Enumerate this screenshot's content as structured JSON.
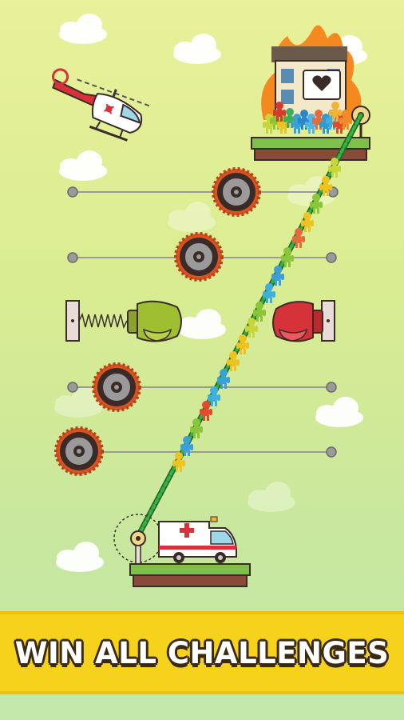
{
  "banner": {
    "text": "WIN ALL CHALLENGES"
  },
  "colors": {
    "background_top": "#e9f19a",
    "banner": "#f7d21c",
    "rope": "#2f9a3a",
    "saw": "#d9531e",
    "glove_left": "#8aa22c",
    "glove_right": "#d6323a",
    "fire": "#f48a1f"
  },
  "icons": [
    "helicopter-icon",
    "burning-house-icon",
    "heart-sign-icon",
    "saw-blade-icon",
    "spring-icon",
    "boxing-glove-icon",
    "ambulance-icon",
    "stickman-icon",
    "pulley-icon"
  ],
  "scene": {
    "obstacles": [
      "saw-blade",
      "saw-blade",
      "spring-boxing-glove",
      "boxing-glove",
      "saw-blade",
      "saw-blade"
    ],
    "stickmen_on_rope": 20,
    "stickmen_on_roof": 14
  }
}
